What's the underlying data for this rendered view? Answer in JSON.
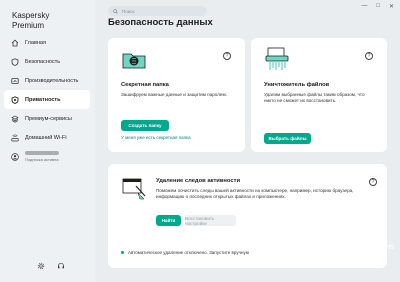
{
  "app": {
    "brand_line1": "Kaspersky",
    "brand_line2": "Premium"
  },
  "window_controls": [
    "—",
    "□",
    "✕"
  ],
  "sidebar": {
    "items": [
      {
        "label": "Главная",
        "icon": "home-icon"
      },
      {
        "label": "Безопасность",
        "icon": "shield-icon"
      },
      {
        "label": "Производительность",
        "icon": "speedometer-icon"
      },
      {
        "label": "Приватность",
        "icon": "privacy-shield-icon",
        "active": true
      },
      {
        "label": "Премиум-сервисы",
        "icon": "stack-icon"
      },
      {
        "label": "Домашний Wi-Fi",
        "icon": "router-icon"
      }
    ],
    "user": {
      "subtitle": "Подписка активна",
      "icon": "user-avatar-icon"
    },
    "bottom_icons": [
      "settings-gear-icon",
      "support-headset-icon"
    ]
  },
  "search": {
    "placeholder": "Поиск"
  },
  "page": {
    "title": "Безопасность данных"
  },
  "cards": {
    "secret_folder": {
      "title": "Секретная папка",
      "description": "Зашифруем важные данные и защитим паролем.",
      "button": "Создать папку",
      "link": "У меня уже есть секретная папка",
      "help": "?"
    },
    "file_shredder": {
      "title": "Уничтожитель файлов",
      "description": "Удалим выбранные файлы таким образом, что никто не сможет их восстановить.",
      "button": "Выбрать файлы",
      "help": "?"
    },
    "activity_cleanup": {
      "title": "Удаление следов активности",
      "description": "Поможем почистить следы вашей активности на компьютере, например, историю браузера, информацию о последних открытых файлах и приложениях.",
      "button_primary": "Найти",
      "button_secondary": "Восстановить настройки",
      "status": "Автоматическое удаление отключено. Запустите вручную",
      "help": "?"
    }
  },
  "watermark": {
    "big": "3D",
    "news": "NEWS",
    "sub": "Daily Digital Digest"
  },
  "colors": {
    "accent": "#00a88e",
    "link": "#00857a",
    "background": "#e9edf0",
    "card": "#ffffff"
  }
}
